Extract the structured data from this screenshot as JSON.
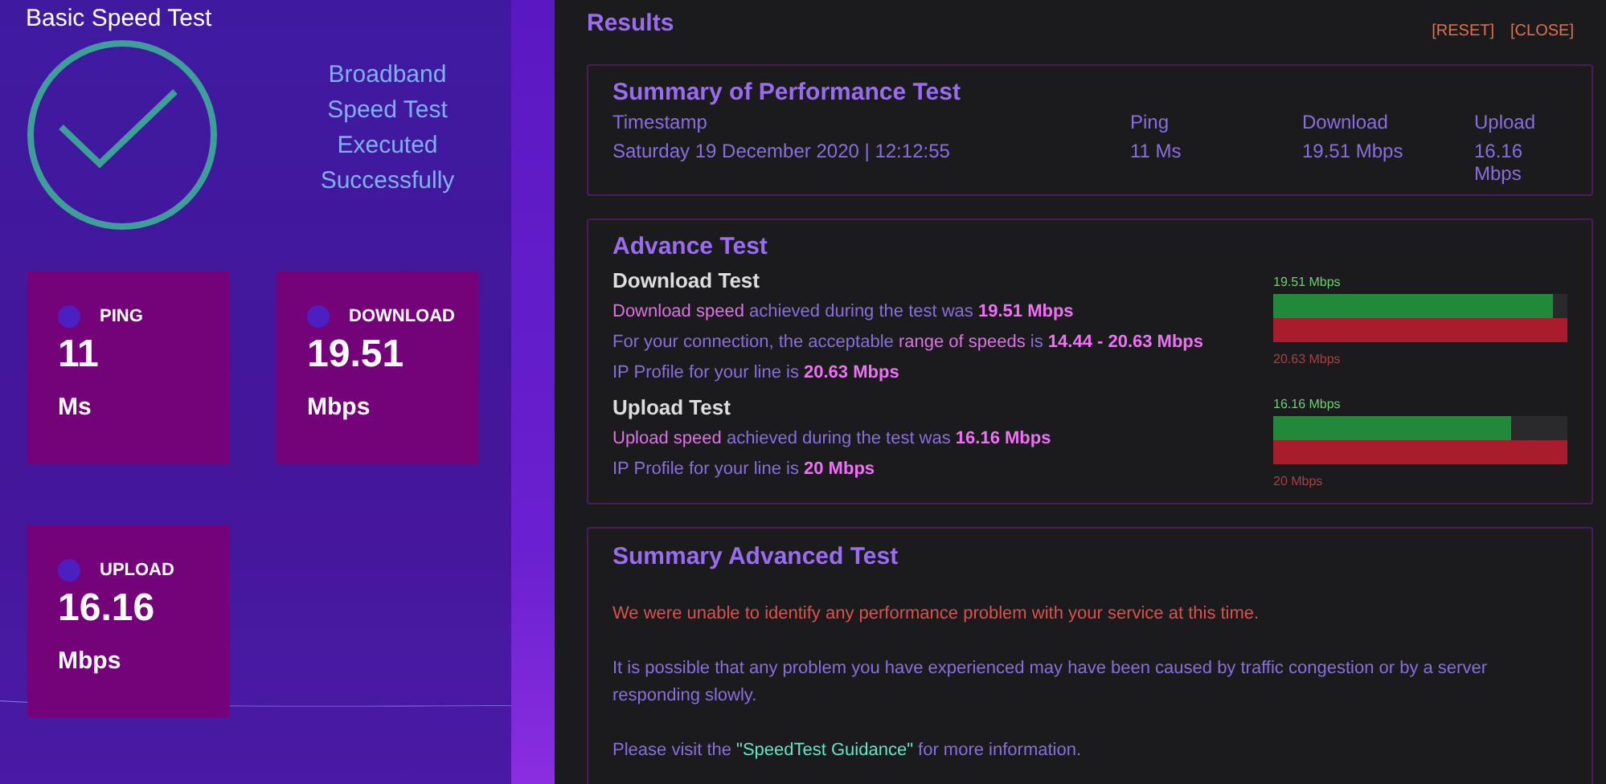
{
  "left": {
    "title": "Basic Speed Test",
    "status_lines": [
      "Broadband",
      "Speed Test",
      "Executed",
      "Successfully"
    ],
    "tiles": [
      {
        "label": "PING",
        "value": "11",
        "unit": "Ms"
      },
      {
        "label": "DOWNLOAD",
        "value": "19.51",
        "unit": "Mbps"
      },
      {
        "label": "UPLOAD",
        "value": "16.16",
        "unit": "Mbps"
      }
    ]
  },
  "results": {
    "title": "Results",
    "actions": [
      "[RESET]",
      "[CLOSE]"
    ],
    "summary": {
      "title": "Summary of Performance Test",
      "columns": [
        {
          "label": "Timestamp",
          "value": "Saturday 19 December 2020 | 12:12:55"
        },
        {
          "label": "Ping",
          "value": "11 Ms"
        },
        {
          "label": "Download",
          "value": "19.51 Mbps"
        },
        {
          "label": "Upload",
          "value": "16.16 Mbps"
        }
      ]
    },
    "advance": {
      "title": "Advance Test",
      "sections": [
        {
          "heading": "Download Test",
          "lines": [
            [
              {
                "kind": "em",
                "text": "Download speed"
              },
              {
                "kind": "plain",
                "text": " achieved during the test was "
              },
              {
                "kind": "strong",
                "text": "19.51 Mbps"
              }
            ],
            [
              {
                "kind": "plain",
                "text": "For your connection, the acceptable "
              },
              {
                "kind": "em",
                "text": "range of speeds"
              },
              {
                "kind": "plain",
                "text": " is "
              },
              {
                "kind": "strong",
                "text": "14.44 - 20.63 Mbps"
              }
            ],
            [
              {
                "kind": "plain",
                "text": "IP Profile for your line is "
              },
              {
                "kind": "strong",
                "text": "20.63 Mbps"
              }
            ]
          ],
          "bar": {
            "measured_label": "19.51 Mbps",
            "level": 0.95,
            "profile_label": "20.63 Mbps"
          }
        },
        {
          "heading": "Upload Test",
          "lines": [
            [
              {
                "kind": "em",
                "text": "Upload speed"
              },
              {
                "kind": "plain",
                "text": " achieved during the test was "
              },
              {
                "kind": "strong",
                "text": "16.16 Mbps"
              }
            ],
            [
              {
                "kind": "plain",
                "text": "IP Profile for your line is "
              },
              {
                "kind": "strong",
                "text": "20 Mbps"
              }
            ]
          ],
          "bar": {
            "measured_label": "16.16 Mbps",
            "level": 0.81,
            "profile_label": "20 Mbps"
          }
        }
      ]
    },
    "summary_advanced": {
      "title": "Summary Advanced Test",
      "paragraphs": [
        {
          "kind": "alert",
          "parts": [
            {
              "kind": "plain",
              "text": "We were unable to identify any performance problem with your service at this time."
            }
          ]
        },
        {
          "kind": "normal",
          "parts": [
            {
              "kind": "plain",
              "text": "It is possible that any problem you have experienced may have been caused by traffic congestion or by a server responding slowly."
            }
          ]
        },
        {
          "kind": "normal",
          "parts": [
            {
              "kind": "plain",
              "text": "Please visit the "
            },
            {
              "kind": "link",
              "text": "\"SpeedTest Guidance\""
            },
            {
              "kind": "plain",
              "text": " for more information."
            }
          ]
        }
      ]
    }
  }
}
